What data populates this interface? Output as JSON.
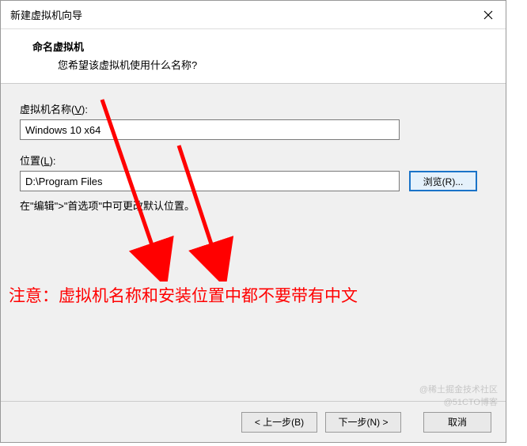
{
  "window": {
    "title": "新建虚拟机向导"
  },
  "header": {
    "heading": "命名虚拟机",
    "subheading": "您希望该虚拟机使用什么名称?"
  },
  "fields": {
    "name_label_pre": "虚拟机名称(",
    "name_label_key": "V",
    "name_label_post": "):",
    "name_value": "Windows 10 x64",
    "location_label_pre": "位置(",
    "location_label_key": "L",
    "location_label_post": "):",
    "location_value": "D:\\Program Files",
    "browse_label": "浏览(R)..."
  },
  "hint": "在\"编辑\">\"首选项\"中可更改默认位置。",
  "warning": "注意：虚拟机名称和安装位置中都不要带有中文",
  "footer": {
    "back": "< 上一步(B)",
    "next": "下一步(N) >",
    "cancel": "取消"
  },
  "watermark": {
    "line1": "@稀土掘金技术社区",
    "line2": "@51CTO博客"
  },
  "colors": {
    "accent_red": "#ff0000",
    "browse_border": "#1a73c8",
    "panel_bg": "#f0f0f0"
  }
}
